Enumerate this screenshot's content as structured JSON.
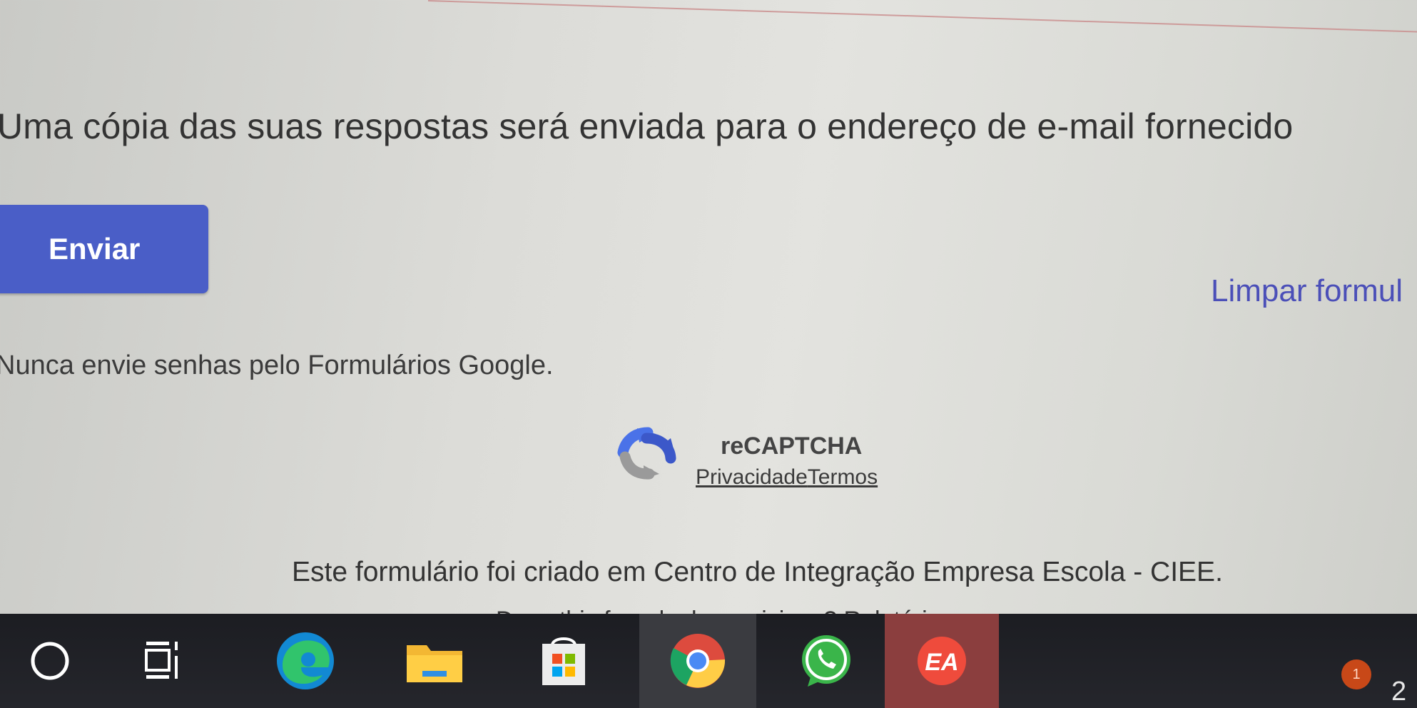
{
  "form": {
    "email_copy_notice": "Uma cópia das suas respostas será enviada para o endereço de e-mail fornecido",
    "submit_label": "Enviar",
    "clear_label": "Limpar formul",
    "password_warning": "Nunca envie senhas pelo Formulários Google.",
    "recaptcha": {
      "title": "reCAPTCHA",
      "privacy_label": "Privacidade",
      "terms_label": "Termos"
    },
    "owner_notice": "Este formulário foi criado em Centro de Integração Empresa Escola - CIEE.",
    "suspicious_question": "Does this form look suspicious? ",
    "report_label": "Relatório"
  },
  "taskbar": {
    "items": [
      {
        "icon": "cortana-search-icon"
      },
      {
        "icon": "task-view-icon"
      },
      {
        "icon": "edge-icon"
      },
      {
        "icon": "file-explorer-icon"
      },
      {
        "icon": "microsoft-store-icon"
      },
      {
        "icon": "chrome-icon",
        "active": true
      },
      {
        "icon": "whatsapp-icon"
      },
      {
        "icon": "ea-app-icon"
      }
    ],
    "notification_count": "1",
    "clock_fragment": "2"
  },
  "colors": {
    "submit_button": "#4a5ec7",
    "clear_link": "#4b4fb8",
    "taskbar_bg": "#1c1d22",
    "ea_app": "#8b3e3e",
    "notification_badge": "#c84818"
  }
}
